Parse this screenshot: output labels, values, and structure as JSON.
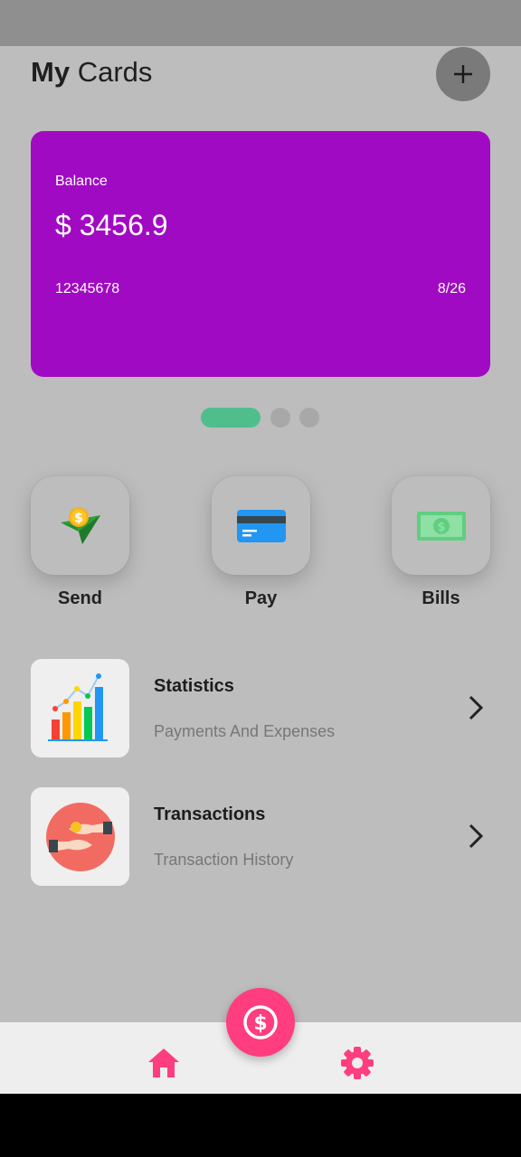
{
  "header": {
    "title_bold": "My",
    "title_rest": "Cards",
    "add_icon": "plus-icon"
  },
  "card": {
    "balance_label": "Balance",
    "balance_value": "$ 3456.9",
    "card_number": "12345678",
    "expiry": "8/26",
    "color": "#a10ac3"
  },
  "pager": {
    "active_index": 0,
    "count": 3
  },
  "actions": [
    {
      "label": "Send",
      "icon": "send-money-icon"
    },
    {
      "label": "Pay",
      "icon": "credit-card-icon"
    },
    {
      "label": "Bills",
      "icon": "banknote-icon"
    }
  ],
  "menu": [
    {
      "title": "Statistics",
      "subtitle": "Payments And Expenses",
      "icon": "bar-chart-icon"
    },
    {
      "title": "Transactions",
      "subtitle": "Transaction History",
      "icon": "hand-exchange-icon"
    }
  ],
  "bottom_nav": {
    "fab_icon": "dollar-icon",
    "items": [
      "home-icon",
      "settings-icon"
    ],
    "accent": "#ff3d7f"
  }
}
